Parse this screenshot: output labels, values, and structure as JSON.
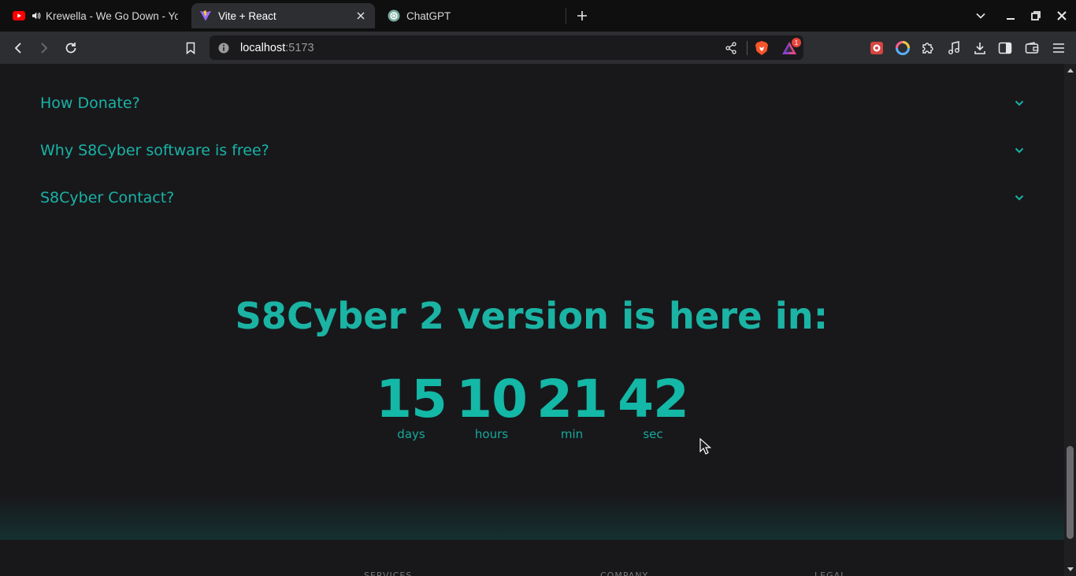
{
  "browser": {
    "tabs": [
      {
        "title": "Krewella - We Go Down - YouT",
        "favicon": "youtube-icon",
        "audio": true,
        "active": false
      },
      {
        "title": "Vite + React",
        "favicon": "vite-icon",
        "active": true
      },
      {
        "title": "ChatGPT",
        "favicon": "chatgpt-icon",
        "active": false
      }
    ],
    "address": {
      "host": "localhost",
      "port": ":5173"
    },
    "shields_badge": "1",
    "accent_colors": {
      "page_accent": "#14b8a6",
      "gradient_end": "#3b93cf",
      "badge": "#e8453c"
    }
  },
  "faq": {
    "items": [
      {
        "question": "How Donate?"
      },
      {
        "question": "Why S8Cyber software is free?"
      },
      {
        "question": "S8Cyber Contact?"
      }
    ]
  },
  "countdown": {
    "headline": "S8Cyber 2 version is here in:",
    "units": [
      {
        "value": "15",
        "label": "days"
      },
      {
        "value": "10",
        "label": "hours"
      },
      {
        "value": "21",
        "label": "min"
      },
      {
        "value": "42",
        "label": "sec"
      }
    ]
  },
  "footer": {
    "columns": [
      "SERVICES",
      "COMPANY",
      "LEGAL"
    ]
  }
}
